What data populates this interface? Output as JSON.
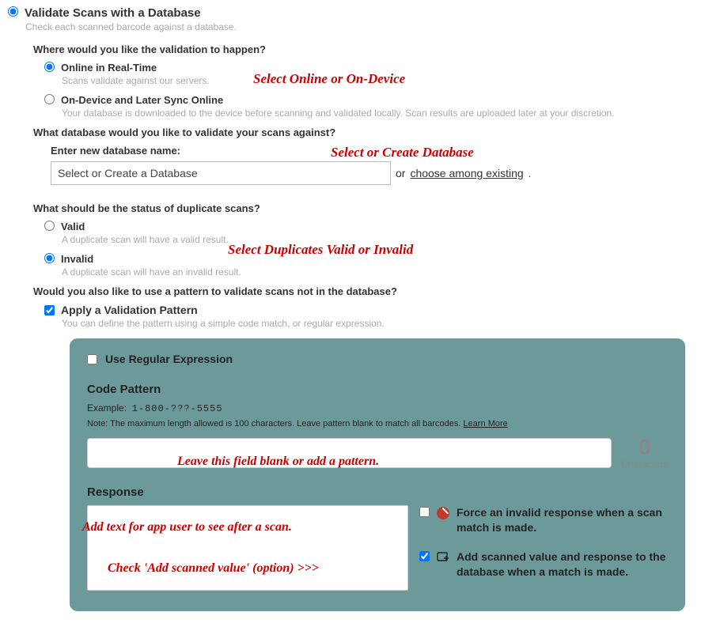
{
  "main": {
    "title": "Validate Scans with a Database",
    "subtitle": "Check each scanned barcode against a database."
  },
  "where": {
    "heading": "Where would you like the validation to happen?",
    "online": {
      "label": "Online in Real-Time",
      "desc": "Scans validate against our servers."
    },
    "ondevice": {
      "label": "On-Device and Later Sync Online",
      "desc": "Your database is downloaded to the device before scanning and validated locally. Scan results are uploaded later at your discretion."
    }
  },
  "database": {
    "heading": "What database would you like to validate your scans against?",
    "enter_label": "Enter new database name:",
    "input_value": "Select or Create a Database",
    "or_text": "or",
    "choose_link": "choose among existing",
    "period": "."
  },
  "duplicates": {
    "heading": "What should be the status of duplicate scans?",
    "valid": {
      "label": "Valid",
      "desc": "A duplicate scan will have a valid result."
    },
    "invalid": {
      "label": "Invalid",
      "desc": "A duplicate scan will have an invalid result."
    }
  },
  "pattern_section": {
    "heading": "Would you also like to use a pattern to validate scans not in the database?",
    "apply_label": "Apply a Validation Pattern",
    "apply_desc": "You can define the pattern using a simple code match, or regular expression."
  },
  "panel": {
    "regex_label": "Use Regular Expression",
    "code_pattern_heading": "Code Pattern",
    "example_prefix": "Example:",
    "example_value": "1-800-???-5555",
    "note_prefix": "Note: The maximum length allowed is 100 characters. Leave pattern blank to match all barcodes.",
    "learn_more": "Learn More",
    "char_count": "0",
    "char_label": "Characters",
    "response_heading": "Response",
    "force_invalid": "Force an invalid response when a scan match is made.",
    "add_scanned": "Add scanned value and response to the database when a match is made."
  },
  "annotations": {
    "a1": "Select Online or On-Device",
    "a2": "Select or Create Database",
    "a3": "Select Duplicates Valid or Invalid",
    "a4": "Leave this field blank or add a pattern.",
    "a5": "Add text for app user to see after a scan.",
    "a6": "Check 'Add scanned value' (option) >>>"
  }
}
